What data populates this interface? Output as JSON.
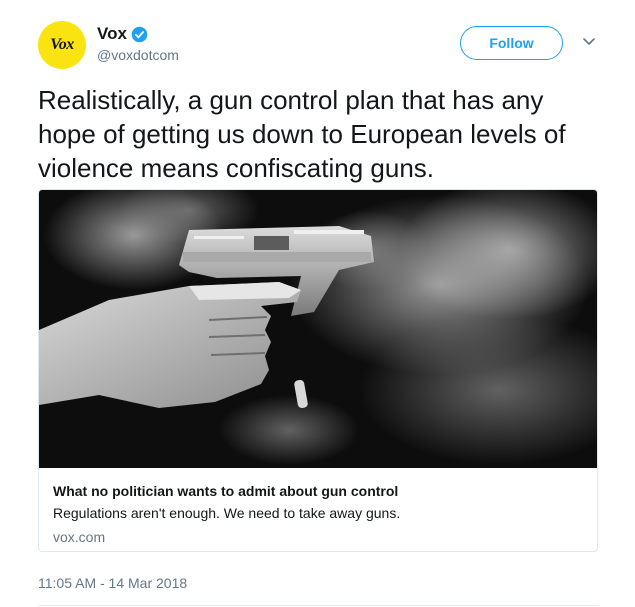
{
  "author": {
    "avatar_text": "Vox",
    "name": "Vox",
    "handle": "@voxdotcom"
  },
  "actions": {
    "follow_label": "Follow"
  },
  "tweet": {
    "text": "Realistically, a gun control plan that has any hope of getting us down to European levels of violence means confiscating guns."
  },
  "card": {
    "title": "What no politician wants to admit about gun control",
    "description": "Regulations aren't enough. We need to take away guns.",
    "domain": "vox.com"
  },
  "timestamp": "11:05 AM - 14 Mar 2018",
  "colors": {
    "accent": "#1da1f2",
    "avatar_bg": "#f9e411",
    "secondary_text": "#657786",
    "border": "#e1e8ed"
  },
  "icons": {
    "verified": "verified-badge-icon",
    "more": "chevron-down-icon"
  }
}
